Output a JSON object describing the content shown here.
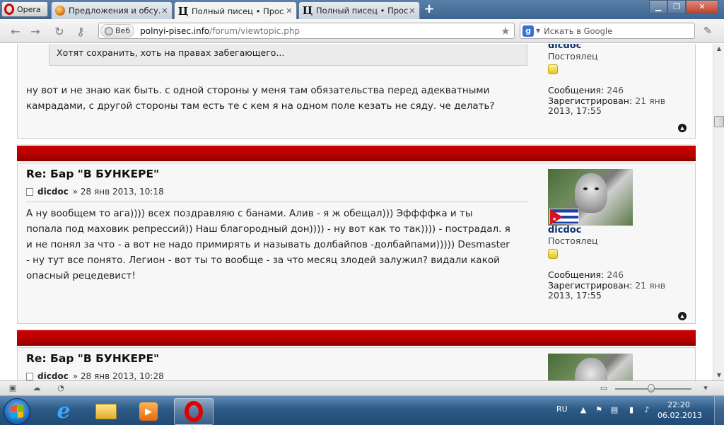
{
  "browser": {
    "menu_label": "Opera",
    "tabs": [
      {
        "title": "Предложения и обсу...",
        "favicon": "ball-favicon"
      },
      {
        "title": "Полный писец • Прос...",
        "favicon": "p-favicon"
      },
      {
        "title": "Полный писец • Прос...",
        "favicon": "p-favicon"
      }
    ],
    "new_tab": "+",
    "address": {
      "chip": "Веб",
      "host": "polnyi-pisec.info",
      "path": "/forum/viewtopic.php"
    },
    "search_placeholder": "Искать в Google"
  },
  "posts": [
    {
      "quote": "Хотят сохранить, хоть на правах забегающего...",
      "lines": [
        "ну вот и не знаю как быть. с одной стороны у меня там обязательства перед адекватными",
        "камрадами, с другой стороны там есть те с кем я на одном поле кезать не сяду. че делать?"
      ],
      "profile": {
        "username": "dicdoc",
        "rank": "Постоялец",
        "posts_label": "Сообщения:",
        "posts_value": "246",
        "reg_label": "Зарегистрирован:",
        "reg_value": "21 янв",
        "reg_value2": "2013, 17:55"
      }
    },
    {
      "title": "Re: Бар \"В БУНКЕРЕ\"",
      "author": "dicdoc",
      "date": "» 28 янв 2013, 10:18",
      "lines": [
        "А ну вообщем то ага)))) всех поздравляю с банами. Алив - я ж обещал))) Эффффка и ты",
        "попала под маховик репрессий)) Наш благородный дон)))) - ну вот как то так)))) - пострадал. я",
        "и не понял за что - а вот не надо примирять и называть долбайпов -долбайпами))))) Desmaster",
        "- ну тут все понято. Легион - вот ты то вообще - за что месяц злодей залужил? видали какой",
        "опасный рецедевист!"
      ],
      "profile": {
        "username": "dicdoc",
        "rank": "Постоялец",
        "posts_label": "Сообщения:",
        "posts_value": "246",
        "reg_label": "Зарегистрирован:",
        "reg_value": "21 янв",
        "reg_value2": "2013, 17:55"
      }
    },
    {
      "title": "Re: Бар \"В БУНКЕРЕ\"",
      "author": "dicdoc",
      "date": "» 28 янв 2013, 10:28"
    }
  ],
  "taskbar": {
    "lang": "RU",
    "time": "22:20",
    "date": "06.02.2013"
  },
  "colors": {
    "accent_red": "#b30000",
    "username_blue": "#0d2f6a"
  }
}
